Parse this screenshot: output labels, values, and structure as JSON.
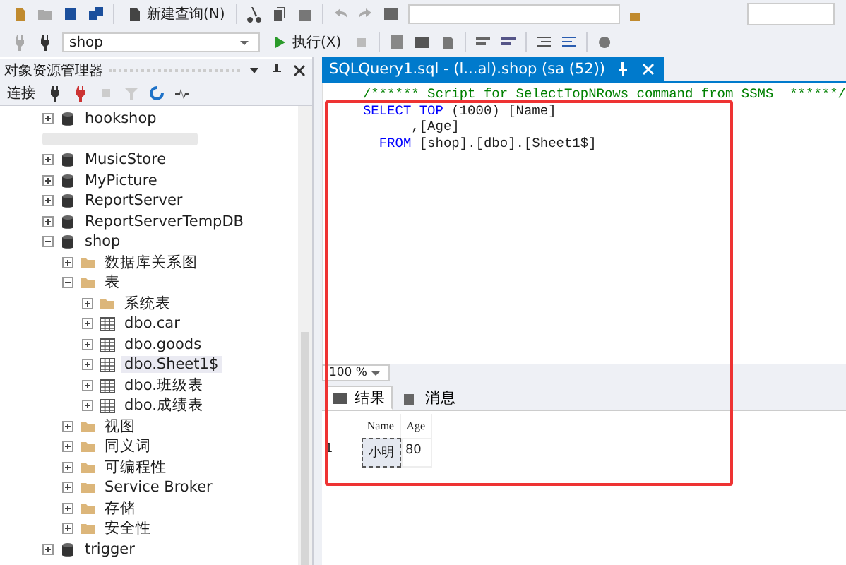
{
  "toolbar": {
    "new_query": "新建查询(N)",
    "database": "shop",
    "execute": "执行(X)"
  },
  "object_explorer": {
    "title": "对象资源管理器",
    "connect": "连接",
    "tree": [
      {
        "label": "hookshop",
        "kind": "database",
        "expanded": false
      },
      {
        "kind": "blurred"
      },
      {
        "label": "MusicStore",
        "kind": "database",
        "expanded": false
      },
      {
        "label": "MyPicture",
        "kind": "database",
        "expanded": false
      },
      {
        "label": "ReportServer",
        "kind": "database",
        "expanded": false
      },
      {
        "label": "ReportServerTempDB",
        "kind": "database",
        "expanded": false
      },
      {
        "label": "shop",
        "kind": "database",
        "expanded": true,
        "children": [
          {
            "label": "数据库关系图",
            "kind": "folder",
            "expanded": false
          },
          {
            "label": "表",
            "kind": "folder",
            "expanded": true,
            "children": [
              {
                "label": "系统表",
                "kind": "folder",
                "expanded": false
              },
              {
                "label": "dbo.car",
                "kind": "table",
                "expanded": false
              },
              {
                "label": "dbo.goods",
                "kind": "table",
                "expanded": false
              },
              {
                "label": "dbo.Sheet1$",
                "kind": "table",
                "expanded": false,
                "selected": true
              },
              {
                "label": "dbo.班级表",
                "kind": "table",
                "expanded": false
              },
              {
                "label": "dbo.成绩表",
                "kind": "table",
                "expanded": false
              }
            ]
          },
          {
            "label": "视图",
            "kind": "folder",
            "expanded": false
          },
          {
            "label": "同义词",
            "kind": "folder",
            "expanded": false
          },
          {
            "label": "可编程性",
            "kind": "folder",
            "expanded": false
          },
          {
            "label": "Service Broker",
            "kind": "folder",
            "expanded": false
          },
          {
            "label": "存储",
            "kind": "folder",
            "expanded": false
          },
          {
            "label": "安全性",
            "kind": "folder",
            "expanded": false
          }
        ]
      },
      {
        "label": "trigger",
        "kind": "database",
        "expanded": false
      }
    ]
  },
  "editor": {
    "tab": "SQLQuery1.sql - (l...al).shop (sa (52))",
    "lines": [
      [
        {
          "kind": "comment",
          "text": "/****** Script for SelectTopNRows command from SSMS  ******/"
        }
      ],
      [
        {
          "kind": "keyword",
          "text": "SELECT TOP "
        },
        {
          "kind": "plain",
          "text": "(1000) [Name]"
        }
      ],
      [
        {
          "kind": "plain",
          "text": "      ,[Age]"
        }
      ],
      [
        {
          "kind": "keyword",
          "text": "  FROM "
        },
        {
          "kind": "plain",
          "text": "[shop].[dbo].[Sheet1$]"
        }
      ]
    ],
    "zoom": "100 %"
  },
  "results": {
    "tabs": [
      {
        "label": "结果",
        "selected": true
      },
      {
        "label": "消息",
        "selected": false
      }
    ],
    "columns": [
      "Name",
      "Age"
    ],
    "rows": [
      {
        "number": "1",
        "cells": [
          "小明",
          "80"
        ]
      }
    ]
  }
}
